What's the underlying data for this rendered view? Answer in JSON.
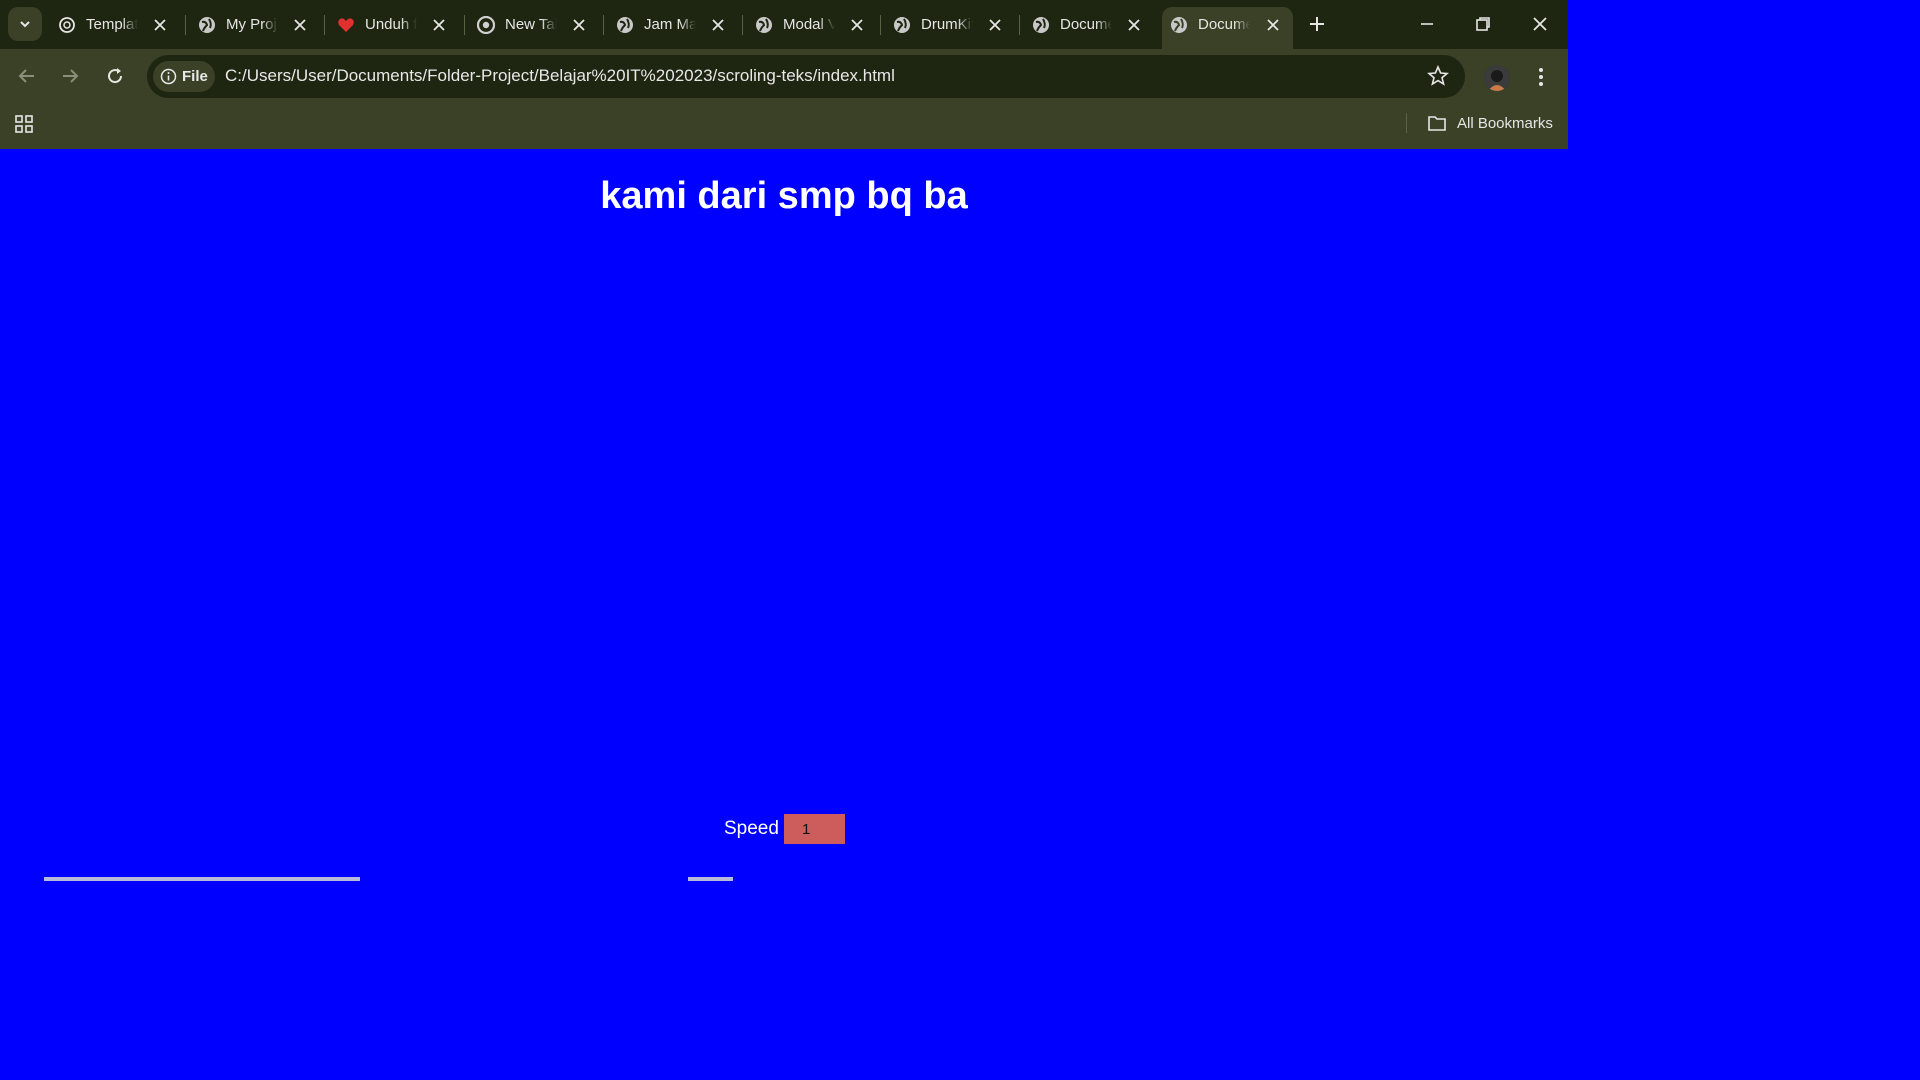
{
  "browser": {
    "tabs": [
      {
        "title": "Templat",
        "icon": "openai-icon",
        "active": false
      },
      {
        "title": "My Proj",
        "icon": "globe-icon",
        "active": false
      },
      {
        "title": "Unduh f",
        "icon": "heart-icon",
        "active": false
      },
      {
        "title": "New Tab",
        "icon": "chrome-icon",
        "active": false
      },
      {
        "title": "Jam Ma",
        "icon": "globe-icon",
        "active": false
      },
      {
        "title": "Modal V",
        "icon": "globe-icon",
        "active": false
      },
      {
        "title": "DrumKit",
        "icon": "globe-icon",
        "active": false
      },
      {
        "title": "Docume",
        "icon": "globe-icon",
        "active": false
      },
      {
        "title": "Docume",
        "icon": "globe-icon",
        "active": true
      }
    ],
    "address": {
      "chip_label": "File",
      "url": "C:/Users/User/Documents/Folder-Project/Belajar%20IT%202023/scroling-teks/index.html"
    },
    "bookmarks_label": "All Bookmarks",
    "theme": {
      "frame": "#1e2510",
      "toolbar": "#3a4126"
    }
  },
  "page": {
    "headline": "kami dari smp bq ba",
    "speed_label": "Speed",
    "speed_value": "1",
    "background": "#0000ff",
    "input_color": "#cd5c5c"
  }
}
